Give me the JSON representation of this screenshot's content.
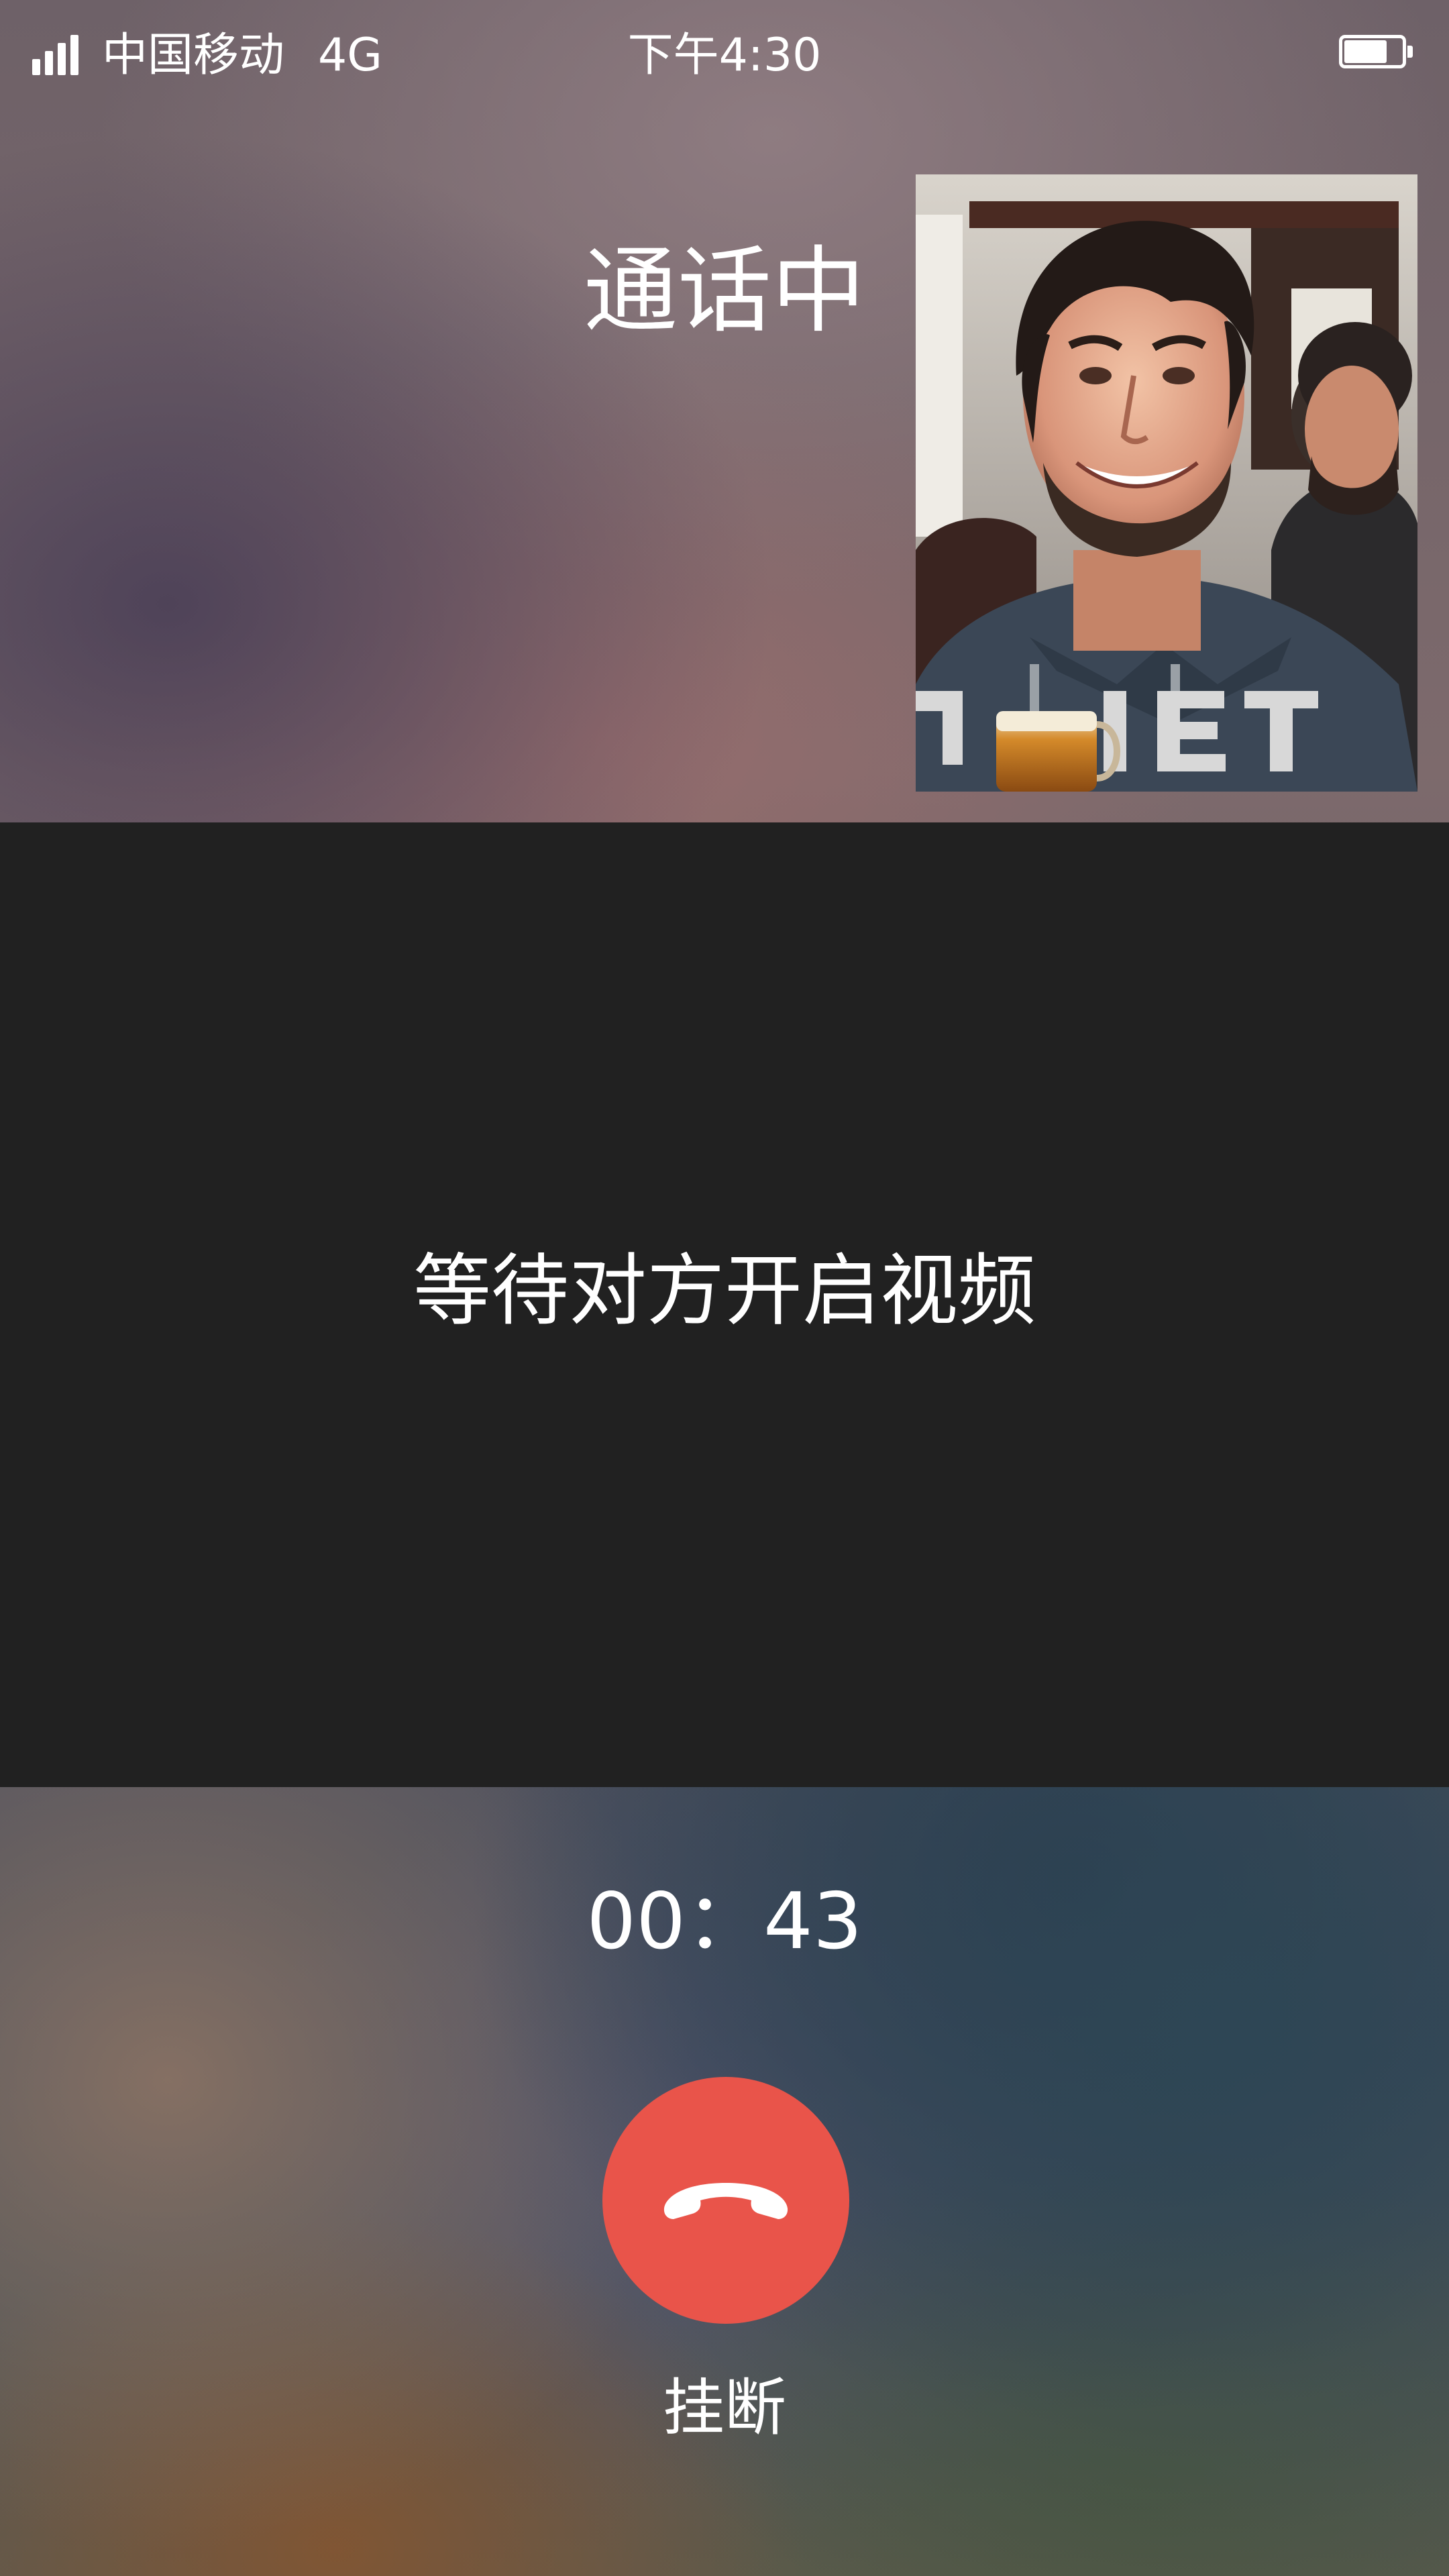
{
  "status_bar": {
    "carrier": "中国移动",
    "network": "4G",
    "time": "下午4:30",
    "signal_bars": 4,
    "battery_level_percent": 75,
    "signal_icon": "signal-icon",
    "battery_icon": "battery-icon"
  },
  "call": {
    "status": "通话中",
    "avatar_icon": "contact-photo",
    "video_message": "等待对方开启视频",
    "duration": "00：43",
    "hangup_label": "挂断",
    "hangup_icon": "phone-hangup-icon"
  },
  "colors": {
    "hangup_button": "#e9544a",
    "video_area": "#212121",
    "text": "#ffffff"
  }
}
